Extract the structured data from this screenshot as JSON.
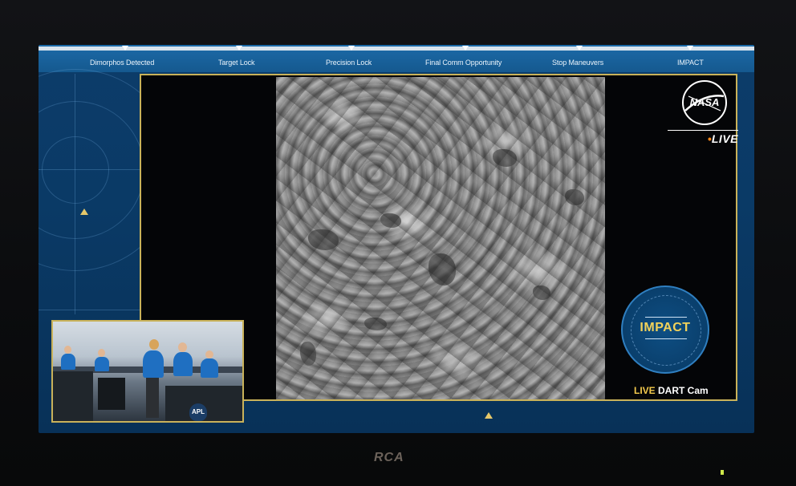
{
  "timeline": {
    "milestones": [
      {
        "label": "Dimorphos Detected"
      },
      {
        "label": "Target Lock"
      },
      {
        "label": "Precision Lock"
      },
      {
        "label": "Final Comm Opportunity"
      },
      {
        "label": "Stop Maneuvers"
      },
      {
        "label": "IMPACT"
      }
    ]
  },
  "overlay": {
    "logo_text": "NASA",
    "live_label": "LIVE",
    "impact_badge": "IMPACT",
    "caption_live": "LIVE",
    "caption_rest": "DART Cam"
  },
  "inset": {
    "badge_text": "APL"
  },
  "tv": {
    "brand": "RCA"
  },
  "colors": {
    "accent_gold": "#c9b25a",
    "impact_yellow": "#f2d25a",
    "live_orange": "#ff8a1a",
    "panel_blue": "#0a3a66"
  }
}
